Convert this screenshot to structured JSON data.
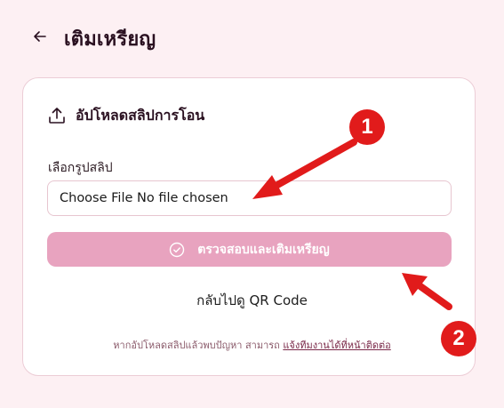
{
  "header": {
    "title": "เติมเหรียญ",
    "back_icon": "arrow-left-icon"
  },
  "card": {
    "title": "อัปโหลดสลิปการโอน",
    "title_icon": "upload-icon",
    "field_label": "เลือกรูปสลิป",
    "file_input_text": "Choose File No file chosen",
    "submit_label": "ตรวจสอบและเติมเหรียญ",
    "submit_icon": "check-circle-icon",
    "qr_link": "กลับไปดู QR Code",
    "help_text": "หากอัปโหลดสลิปแล้วพบปัญหา สามารถ",
    "help_link": "แจ้งทีมงานได้ที่หน้าติดต่อ"
  },
  "annotations": {
    "badge_1": "1",
    "badge_2": "2"
  },
  "colors": {
    "background": "#fdf0f3",
    "button": "#e8a3bf",
    "annotation_red": "#e11b1b"
  }
}
